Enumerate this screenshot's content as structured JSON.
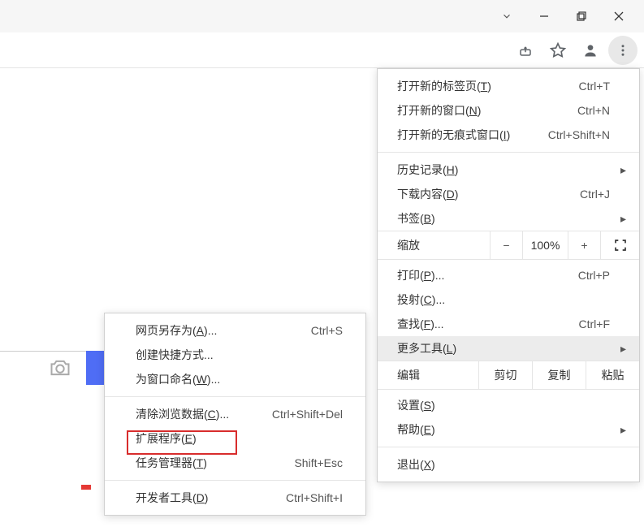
{
  "window": {
    "min": "—",
    "chevron": "⌄"
  },
  "menu": {
    "newTab": {
      "label": "打开新的标签页",
      "mn": "T",
      "shc": "Ctrl+T"
    },
    "newWindow": {
      "label": "打开新的窗口",
      "mn": "N",
      "shc": "Ctrl+N"
    },
    "incognito": {
      "label": "打开新的无痕式窗口",
      "mn": "I",
      "shc": "Ctrl+Shift+N"
    },
    "history": {
      "label": "历史记录",
      "mn": "H"
    },
    "downloads": {
      "label": "下载内容",
      "mn": "D",
      "shc": "Ctrl+J"
    },
    "bookmarks": {
      "label": "书签",
      "mn": "B"
    },
    "zoom": {
      "label": "缩放",
      "val": "100%",
      "minus": "−",
      "plus": "+"
    },
    "print": {
      "label": "打印",
      "mn": "P",
      "shc": "Ctrl+P",
      "dots": "..."
    },
    "cast": {
      "label": "投射",
      "mn": "C",
      "dots": "..."
    },
    "find": {
      "label": "查找",
      "mn": "F",
      "shc": "Ctrl+F",
      "dots": "..."
    },
    "moreTools": {
      "label": "更多工具",
      "mn": "L"
    },
    "edit": {
      "label": "编辑",
      "cut": "剪切",
      "copy": "复制",
      "paste": "粘贴"
    },
    "settings": {
      "label": "设置",
      "mn": "S"
    },
    "help": {
      "label": "帮助",
      "mn": "E"
    },
    "exit": {
      "label": "退出",
      "mn": "X"
    }
  },
  "sub": {
    "saveAs": {
      "label": "网页另存为",
      "mn": "A",
      "shc": "Ctrl+S",
      "dots": "..."
    },
    "shortcut": {
      "label": "创建快捷方式",
      "dots": "..."
    },
    "nameWin": {
      "label": "为窗口命名",
      "mn": "W",
      "dots": "..."
    },
    "clearData": {
      "label": "清除浏览数据",
      "mn": "C",
      "shc": "Ctrl+Shift+Del",
      "dots": "..."
    },
    "extensions": {
      "label": "扩展程序",
      "mn": "E"
    },
    "taskMgr": {
      "label": "任务管理器",
      "mn": "T",
      "shc": "Shift+Esc"
    },
    "devTools": {
      "label": "开发者工具",
      "mn": "D",
      "shc": "Ctrl+Shift+I"
    }
  }
}
